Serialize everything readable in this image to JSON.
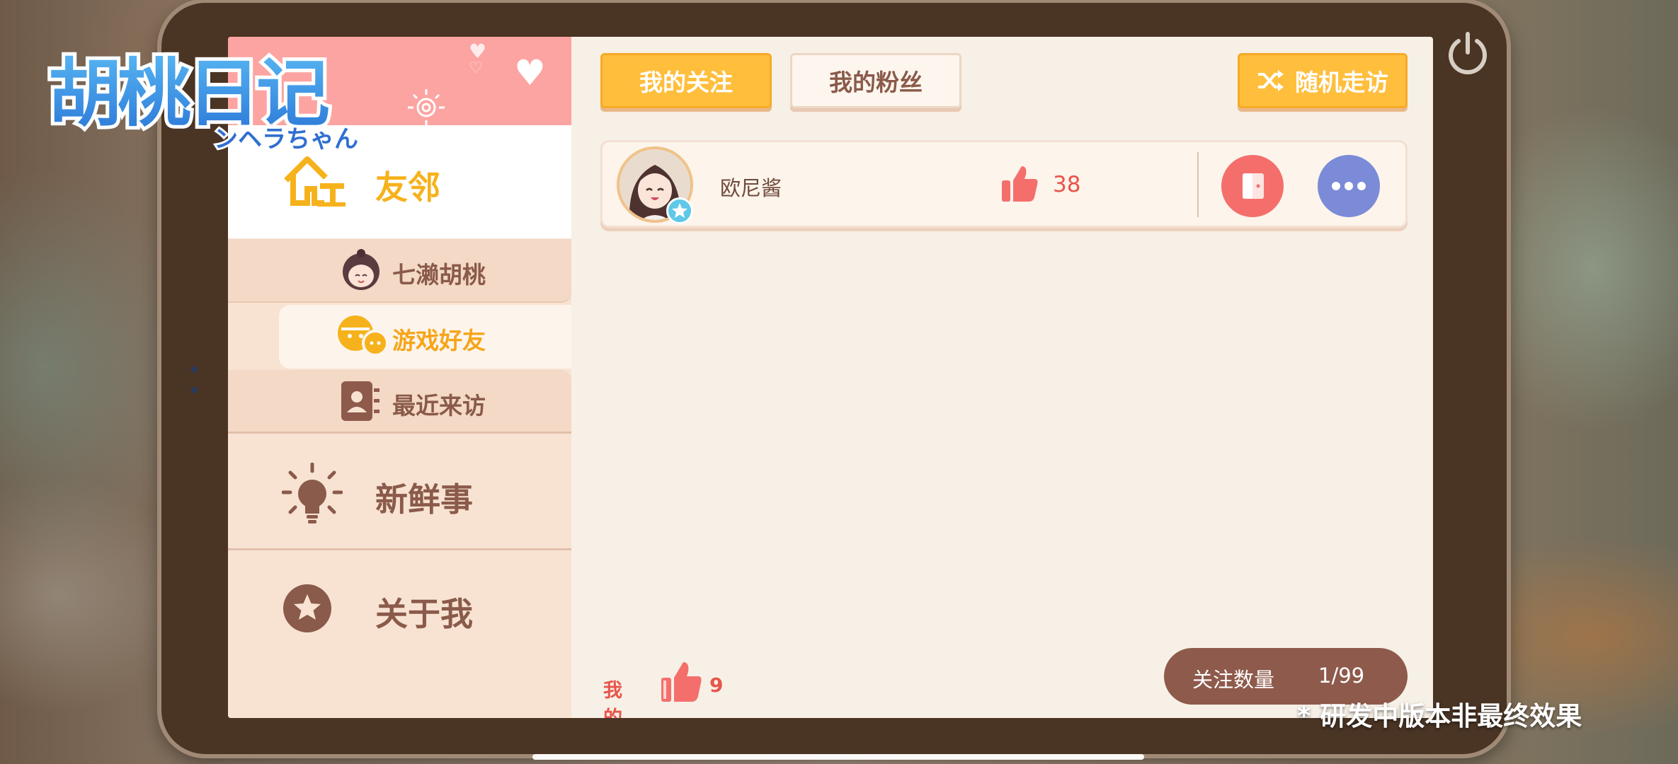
{
  "game": {
    "logo_title": "胡桃日记",
    "logo_subtitle": "ンヘラちゃん"
  },
  "sidebar": {
    "main_nav": [
      {
        "label": "友邻",
        "icon": "house-icon",
        "selected": true
      },
      {
        "label": "新鲜事",
        "icon": "lightbulb-icon",
        "selected": false
      },
      {
        "label": "关于我",
        "icon": "star-icon",
        "selected": false
      }
    ],
    "sub_nav": [
      {
        "label": "七濑胡桃",
        "icon": "character-face-icon",
        "selected": false
      },
      {
        "label": "游戏好友",
        "icon": "chat-faces-icon",
        "selected": true
      },
      {
        "label": "最近来访",
        "icon": "contact-book-icon",
        "selected": false
      }
    ]
  },
  "tabs": {
    "following": "我的关注",
    "fans": "我的粉丝",
    "random_visit": "随机走访"
  },
  "friends": [
    {
      "name": "欧尼酱",
      "likes": "38"
    }
  ],
  "my_likes": {
    "label": "我的",
    "count": "9"
  },
  "follow_count": {
    "label": "关注数量",
    "value": "1/99"
  },
  "watermark": "* 研发中版本非最终效果",
  "colors": {
    "accent_yellow": "#ffbe3c",
    "brown": "#8e5a4b",
    "like_red": "#e9544a",
    "pink_header": "#fca4a2",
    "more_blue": "#7b8bd8"
  }
}
